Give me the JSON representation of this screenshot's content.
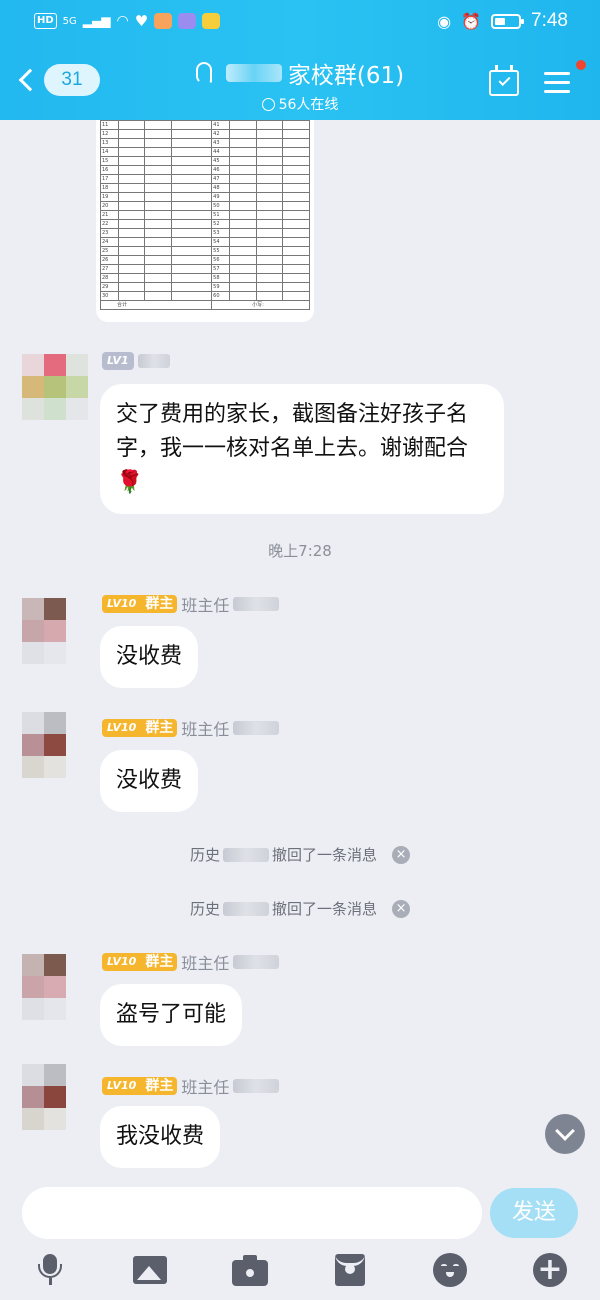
{
  "status_bar": {
    "hd": "HD",
    "signal": "5G",
    "time": "7:48"
  },
  "header": {
    "back_count": "31",
    "title": "家校群(61)",
    "online": "56人在线"
  },
  "spreadsheet": {
    "left_rows": [
      "11",
      "12",
      "13",
      "14",
      "15",
      "16",
      "17",
      "18",
      "19",
      "20",
      "21",
      "22",
      "23",
      "24",
      "25",
      "26",
      "27",
      "28",
      "29",
      "30"
    ],
    "right_rows": [
      "41",
      "42",
      "43",
      "44",
      "45",
      "46",
      "47",
      "48",
      "49",
      "50",
      "51",
      "52",
      "53",
      "54",
      "55",
      "56",
      "57",
      "58",
      "59",
      "60"
    ],
    "footer_left": "合计",
    "footer_right": "小写:"
  },
  "messages": [
    {
      "level": "LV1",
      "owner_badge": "",
      "sender_prefix": "",
      "text": "交了费用的家长，截图备注好孩子名字，我一一核对名单上去。谢谢配合🌹"
    },
    {
      "level": "LV10",
      "owner_badge": "群主",
      "sender_prefix": "班主任",
      "text": "没收费"
    },
    {
      "level": "LV10",
      "owner_badge": "群主",
      "sender_prefix": "班主任",
      "text": "没收费"
    },
    {
      "level": "LV10",
      "owner_badge": "群主",
      "sender_prefix": "班主任",
      "text": "盗号了可能"
    },
    {
      "level": "LV10",
      "owner_badge": "群主",
      "sender_prefix": "班主任",
      "text": "我没收费"
    }
  ],
  "time_divider": "晚上7:28",
  "recalls": [
    {
      "prefix": "历史",
      "suffix": "撤回了一条消息"
    },
    {
      "prefix": "历史",
      "suffix": "撤回了一条消息"
    }
  ],
  "input": {
    "send_label": "发送"
  },
  "icons": [
    "ear-icon",
    "calendar-check-icon",
    "menu-icon",
    "mic-icon",
    "image-icon",
    "camera-icon",
    "red-packet-icon",
    "emoji-icon",
    "plus-icon",
    "close-icon",
    "chevron-down-icon"
  ],
  "colors": {
    "header_accent": "#22b8f0",
    "level_badge": "#f5b52c",
    "send_button": "#a4dff5",
    "notification_dot": "#f0462f"
  }
}
